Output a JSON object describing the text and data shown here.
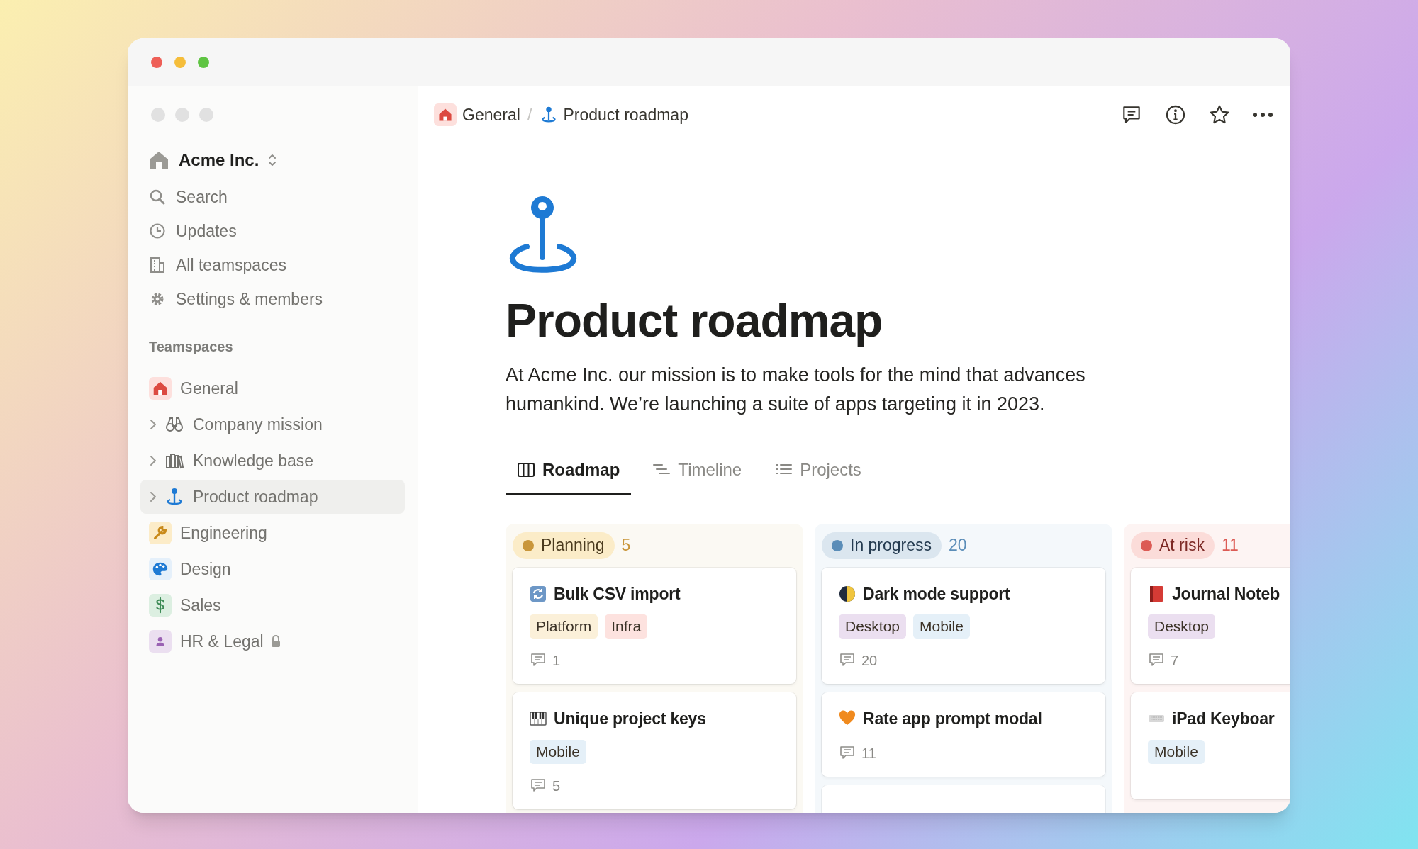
{
  "sidebar": {
    "workspace": "Acme Inc.",
    "nav": [
      {
        "label": "Search"
      },
      {
        "label": "Updates"
      },
      {
        "label": "All teamspaces"
      },
      {
        "label": "Settings & members"
      }
    ],
    "section_title": "Teamspaces",
    "teamspaces": [
      {
        "label": "General",
        "expandable": false,
        "selected": false,
        "locked": false
      },
      {
        "label": "Company mission",
        "expandable": true,
        "selected": false,
        "locked": false
      },
      {
        "label": "Knowledge base",
        "expandable": true,
        "selected": false,
        "locked": false
      },
      {
        "label": "Product roadmap",
        "expandable": true,
        "selected": true,
        "locked": false
      },
      {
        "label": "Engineering",
        "expandable": false,
        "selected": false,
        "locked": false
      },
      {
        "label": "Design",
        "expandable": false,
        "selected": false,
        "locked": false
      },
      {
        "label": "Sales",
        "expandable": false,
        "selected": false,
        "locked": false
      },
      {
        "label": "HR & Legal",
        "expandable": false,
        "selected": false,
        "locked": true
      }
    ]
  },
  "breadcrumbs": [
    "General",
    "Product roadmap"
  ],
  "breadcrumb_separator": "/",
  "page": {
    "title": "Product roadmap",
    "description": "At Acme Inc. our mission is to make tools for the mind that advances humankind. We’re launching a suite of apps targeting it in 2023."
  },
  "tabs": [
    {
      "label": "Roadmap",
      "selected": true
    },
    {
      "label": "Timeline",
      "selected": false
    },
    {
      "label": "Projects",
      "selected": false
    }
  ],
  "columns": [
    {
      "status": "Planning",
      "count": "5",
      "color": "#c9963a",
      "cards": [
        {
          "title": "Bulk CSV import",
          "tags": [
            {
              "label": "Platform",
              "color": "#fbf0d9"
            },
            {
              "label": "Infra",
              "color": "#fde2df"
            }
          ],
          "comments": "1"
        },
        {
          "title": "Unique project keys",
          "tags": [
            {
              "label": "Mobile",
              "color": "#e5f0f8"
            }
          ],
          "comments": "5"
        }
      ]
    },
    {
      "status": "In progress",
      "count": "20",
      "color": "#5b8db8",
      "cards": [
        {
          "title": "Dark mode support",
          "tags": [
            {
              "label": "Desktop",
              "color": "#ebdff0"
            },
            {
              "label": "Mobile",
              "color": "#e5f0f8"
            }
          ],
          "comments": "20"
        },
        {
          "title": "Rate app prompt modal",
          "comments": "11"
        }
      ]
    },
    {
      "status": "At risk",
      "count": "11",
      "color": "#dc5b55",
      "cards": [
        {
          "title": "Journal Noteb",
          "tags": [
            {
              "label": "Desktop",
              "color": "#ebdff0"
            }
          ],
          "comments": "7"
        },
        {
          "title": "iPad Keyboar",
          "tags": [
            {
              "label": "Mobile",
              "color": "#e5f0f8"
            }
          ]
        }
      ]
    }
  ]
}
